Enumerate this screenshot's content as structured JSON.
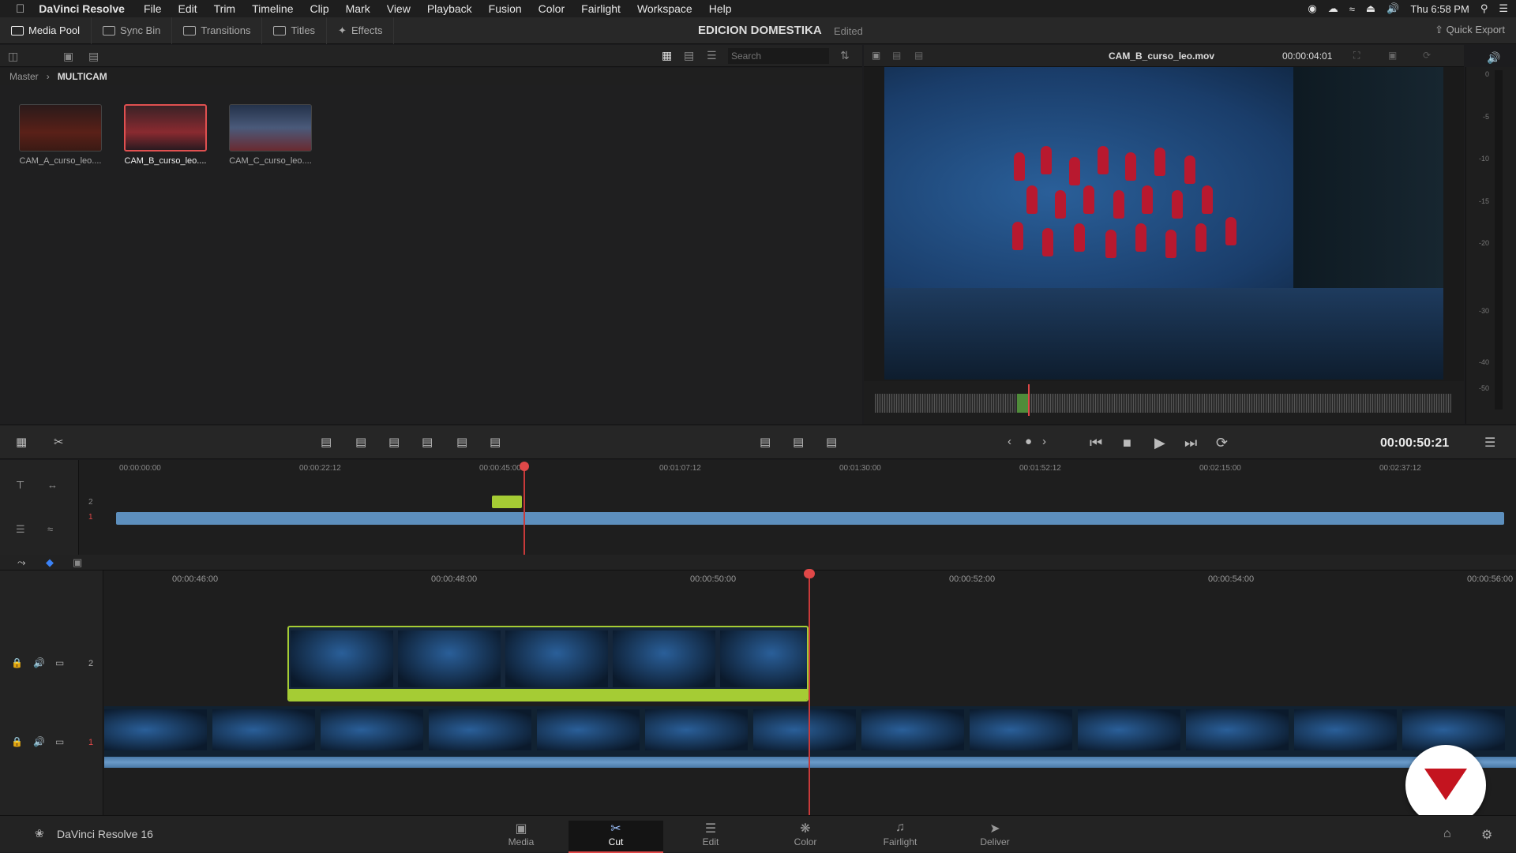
{
  "menubar": {
    "app": "DaVinci Resolve",
    "items": [
      "File",
      "Edit",
      "Trim",
      "Timeline",
      "Clip",
      "Mark",
      "View",
      "Playback",
      "Fusion",
      "Color",
      "Fairlight",
      "Workspace",
      "Help"
    ],
    "clock": "Thu 6:58 PM"
  },
  "toolbar": {
    "media_pool": "Media Pool",
    "sync_bin": "Sync Bin",
    "transitions": "Transitions",
    "titles": "Titles",
    "effects": "Effects",
    "project_title": "EDICION DOMESTIKA",
    "project_status": "Edited",
    "quick_export": "Quick Export"
  },
  "pool": {
    "search_placeholder": "Search",
    "breadcrumb": [
      "Master",
      "MULTICAM"
    ],
    "clips": [
      {
        "name": "CAM_A_curso_leo....",
        "selected": false
      },
      {
        "name": "CAM_B_curso_leo....",
        "selected": true
      },
      {
        "name": "CAM_C_curso_leo....",
        "selected": false
      }
    ]
  },
  "viewer": {
    "clip_name": "CAM_B_curso_leo.mov",
    "clip_duration": "00:00:04:01",
    "timecode": "00:00:50:21"
  },
  "meter": {
    "levels": [
      "0",
      "-5",
      "-10",
      "-15",
      "-20",
      "-30",
      "-40",
      "-50"
    ]
  },
  "upper_timeline": {
    "ticks": [
      "00:00:00:00",
      "00:00:22:12",
      "00:00:45:00",
      "00:01:07:12",
      "00:01:30:00",
      "00:01:52:12",
      "00:02:15:00",
      "00:02:37:12"
    ],
    "tracks": [
      "2",
      "1"
    ]
  },
  "lower_timeline": {
    "ticks": [
      "00:00:46:00",
      "00:00:48:00",
      "00:00:50:00",
      "00:00:52:00",
      "00:00:54:00",
      "00:00:56:00"
    ],
    "tracks": [
      "2",
      "1"
    ]
  },
  "footer": {
    "brand": "DaVinci Resolve 16",
    "pages": [
      "Media",
      "Cut",
      "Edit",
      "Color",
      "Fairlight",
      "Deliver"
    ],
    "active_page": "Cut"
  },
  "colors": {
    "accent_red": "#e04848",
    "clip_green": "#a5cc34",
    "track_blue": "#5d8fbd"
  }
}
